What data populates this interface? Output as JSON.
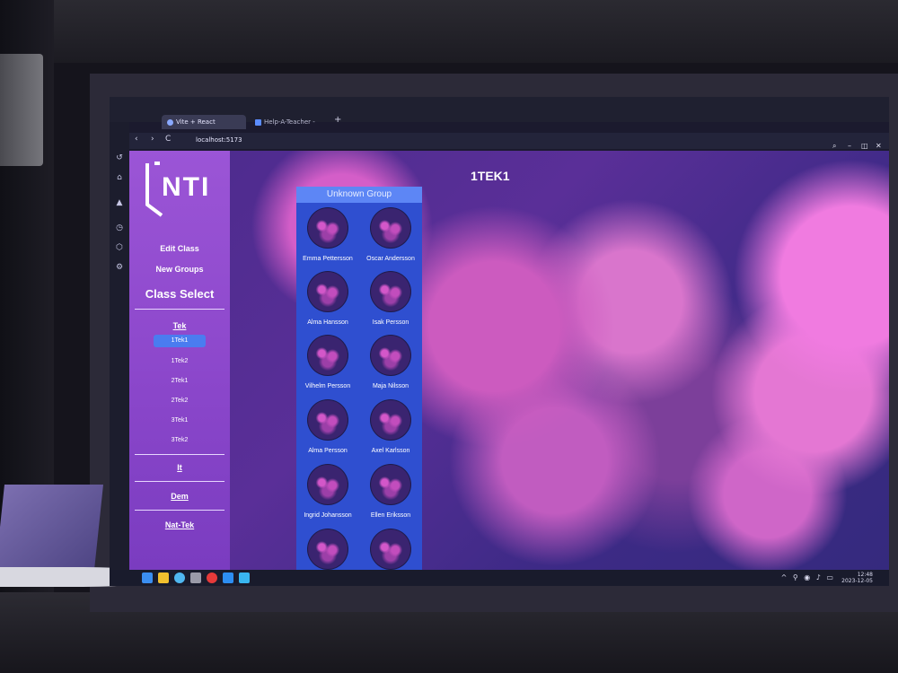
{
  "browser": {
    "tabs": [
      {
        "label": "Vite + React",
        "active": true
      },
      {
        "label": "Help-A-Teacher - Present",
        "active": false
      }
    ],
    "new_tab_label": "+",
    "url": "localhost:5173",
    "nav": {
      "back": "‹",
      "forward": "›",
      "reload": "C"
    },
    "window_controls": {
      "search": "⌕",
      "minimize": "–",
      "maximize": "◫",
      "close": "✕"
    },
    "extensions": "◩ ◎ ● ◎ ☆ ♡ ⇩ ☰ ◉"
  },
  "sidebar": {
    "links": [
      "Edit Class",
      "New Groups"
    ],
    "title": "Class Select",
    "groups": [
      {
        "label": "Tek",
        "classes": [
          "1Tek1",
          "1Tek2",
          "2Tek1",
          "2Tek2",
          "3Tek1",
          "3Tek2"
        ],
        "selected": "1Tek1"
      },
      {
        "label": "It",
        "classes": []
      },
      {
        "label": "Dem",
        "classes": []
      },
      {
        "label": "Nat-Tek",
        "classes": []
      }
    ]
  },
  "main": {
    "class_title": "1TEK1",
    "group": {
      "header": "Unknown Group",
      "students": [
        "Emma Pettersson",
        "Oscar Andersson",
        "Alma Hansson",
        "Isak Persson",
        "Vilhelm Persson",
        "Maja Nilsson",
        "Alma Persson",
        "Axel Karlsson",
        "Ingrid Johansson",
        "Ellen Eriksson",
        "",
        ""
      ]
    }
  },
  "taskbar": {
    "time": "12:48",
    "date": "2023-12-05",
    "tray": "^ ⚲ ◉ ♪ ▭"
  },
  "colors": {
    "sidebar": "#8d48cc",
    "active_class": "#4a7cf0",
    "group_panel": "#2f4fd0",
    "group_header": "#5d86f5"
  }
}
